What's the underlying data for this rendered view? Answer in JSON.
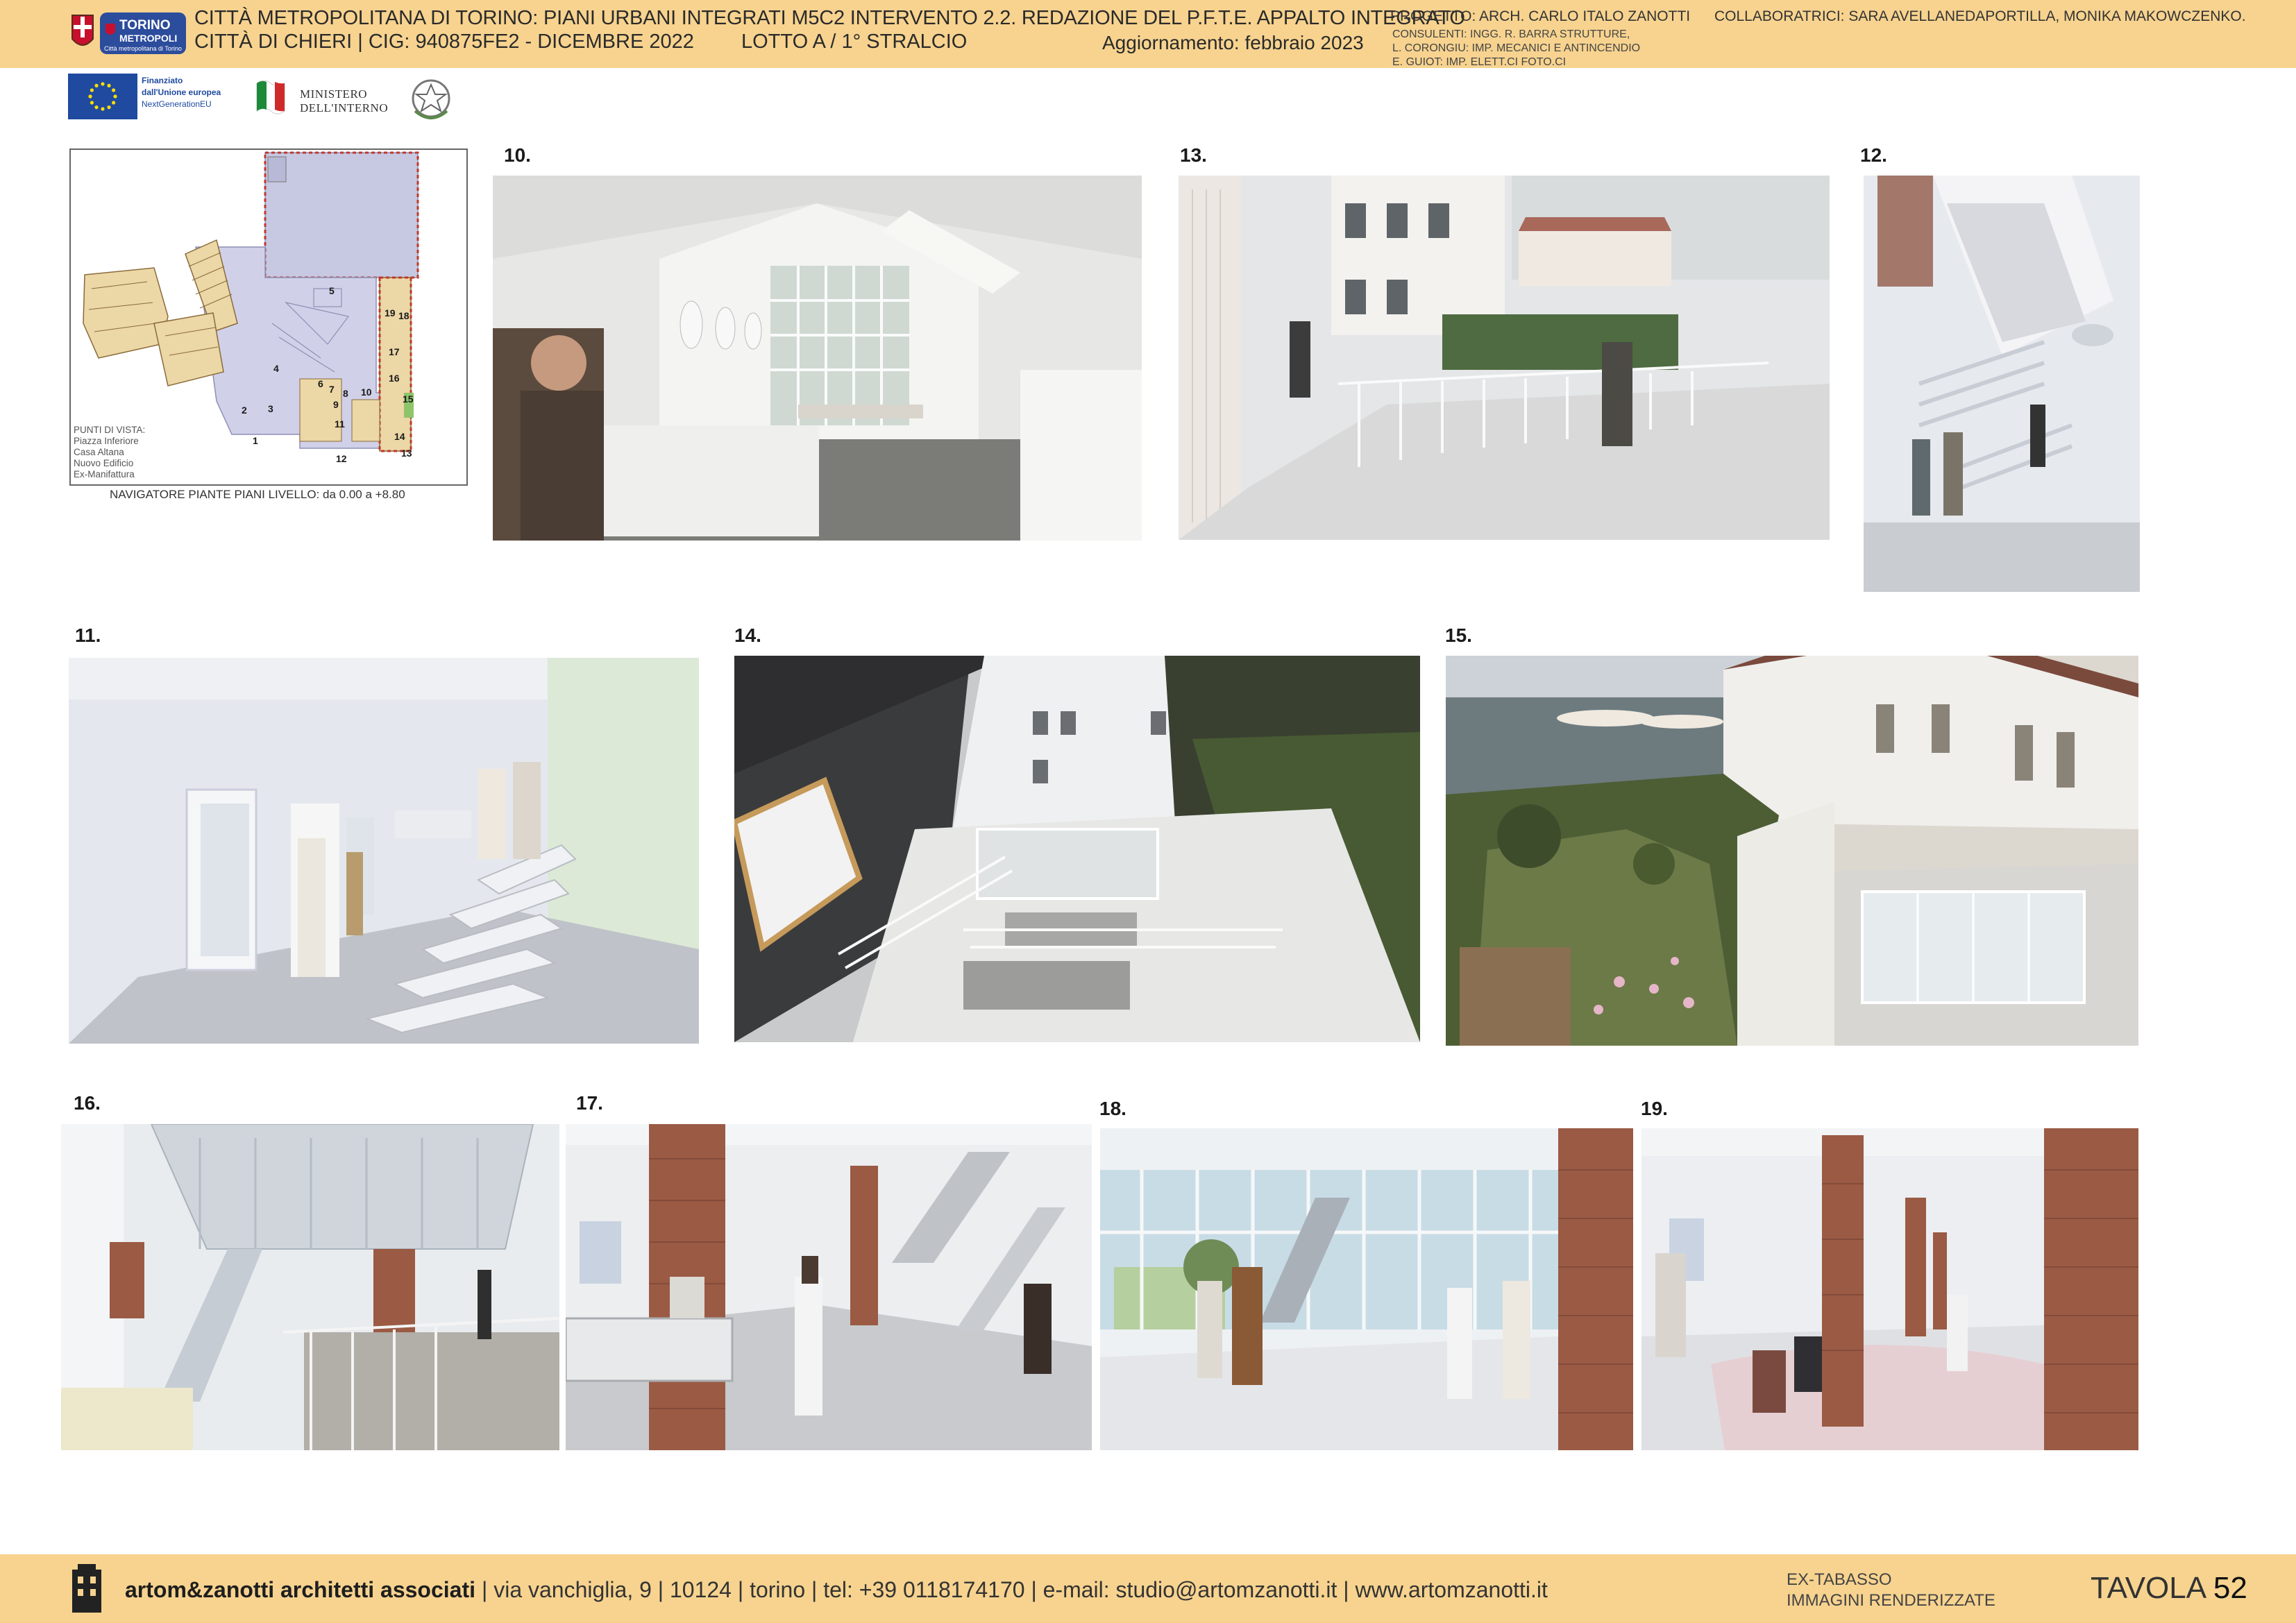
{
  "header": {
    "title_line1": "CITTÀ METROPOLITANA DI TORINO: PIANI URBANI INTEGRATI M5C2 INTERVENTO 2.2. REDAZIONE DEL P.F.T.E. APPALTO INTEGRATO",
    "title_line2": "CITTÀ DI CHIERI  |  CIG: 940875FE2  - DICEMBRE 2022",
    "lotto": "LOTTO A / 1° STRALCIO",
    "aggiornamento": "Aggiornamento: febbraio 2023",
    "progetto": "PROGETTO: ARCH. CARLO ITALO ZANOTTI",
    "consulenti": [
      "CONSULENTI: INGG. R. BARRA STRUTTURE,",
      "L. CORONGIU: IMP. MECANICI E ANTINCENDIO",
      "E. GUIOT: IMP. ELETT.CI FOTO.CI"
    ],
    "collaboratrici": "COLLABORATRICI: SARA AVELLANEDAPORTILLA, MONIKA MAKOWCZENKO.",
    "logo_torino_lines": [
      "TORINO",
      "METROPOLI",
      "Città metropolitana di Torino"
    ]
  },
  "funding": {
    "eu_lines": [
      "Finanziato",
      "dall'Unione europea",
      "NextGenerationEU"
    ],
    "ministero_lines": [
      "MINISTERO",
      "DELL'INTERNO"
    ]
  },
  "navigator": {
    "legend": [
      "PUNTI DI VISTA:",
      "Piazza Inferiore",
      "Casa Altana",
      "Nuovo Edificio",
      "Ex-Manifattura"
    ],
    "caption": "NAVIGATORE PIANTE PIANI LIVELLO:  da 0.00 a +8.80",
    "points": [
      "1",
      "2",
      "3",
      "4",
      "5",
      "6",
      "7",
      "8",
      "9",
      "10",
      "11",
      "12",
      "13",
      "14",
      "15",
      "16",
      "17",
      "18",
      "19"
    ]
  },
  "renders": [
    {
      "num": "10.",
      "subject": "kitchen"
    },
    {
      "num": "13.",
      "subject": "terrace"
    },
    {
      "num": "12.",
      "subject": "stair-vertical"
    },
    {
      "num": "11.",
      "subject": "stair-corridor"
    },
    {
      "num": "14.",
      "subject": "courtyard"
    },
    {
      "num": "15.",
      "subject": "roof-garden"
    },
    {
      "num": "16.",
      "subject": "stair-atrium"
    },
    {
      "num": "17.",
      "subject": "hall-brick"
    },
    {
      "num": "18.",
      "subject": "glass-hall"
    },
    {
      "num": "19.",
      "subject": "lounge"
    }
  ],
  "footer": {
    "firm": "artom&zanotti architetti associati",
    "address": "| via vanchiglia, 9 | 10124 | torino | tel: +39 0118174170 | e-mail: studio@artomzanotti.it | www.artomzanotti.it",
    "ex_lines": [
      "EX-TABASSO",
      "IMMAGINI RENDERIZZATE"
    ],
    "tavola_label": "TAVOLA",
    "tavola_num": "52"
  },
  "colors": {
    "band": "#f7d38f",
    "plan_lilac": "#c7c8e2",
    "plan_tan": "#ecd7a6",
    "plan_red": "#c0392b",
    "brick": "#9a5a44"
  }
}
